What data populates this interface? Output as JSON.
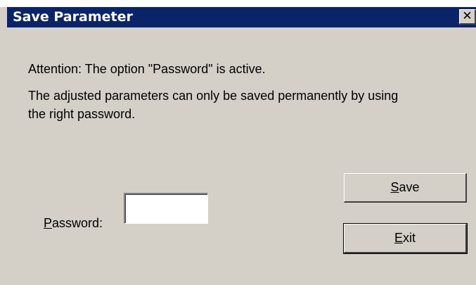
{
  "window": {
    "title": "Save Parameter",
    "close_glyph": "✕",
    "close_icon": "close-icon"
  },
  "message": {
    "attention": "Attention: The option \"Password\" is active.",
    "info_line1": "The adjusted parameters can only be saved permanently by using",
    "info_line2": "the right password."
  },
  "password": {
    "label_mnemonic": "P",
    "label_rest": "assword:",
    "value": "",
    "placeholder": ""
  },
  "buttons": {
    "save_mnemonic": "S",
    "save_rest": "ave",
    "exit_mnemonic": "E",
    "exit_rest": "xit"
  },
  "colors": {
    "titlebar": "#0a246a",
    "dialog_bg": "#d4d0c8"
  }
}
